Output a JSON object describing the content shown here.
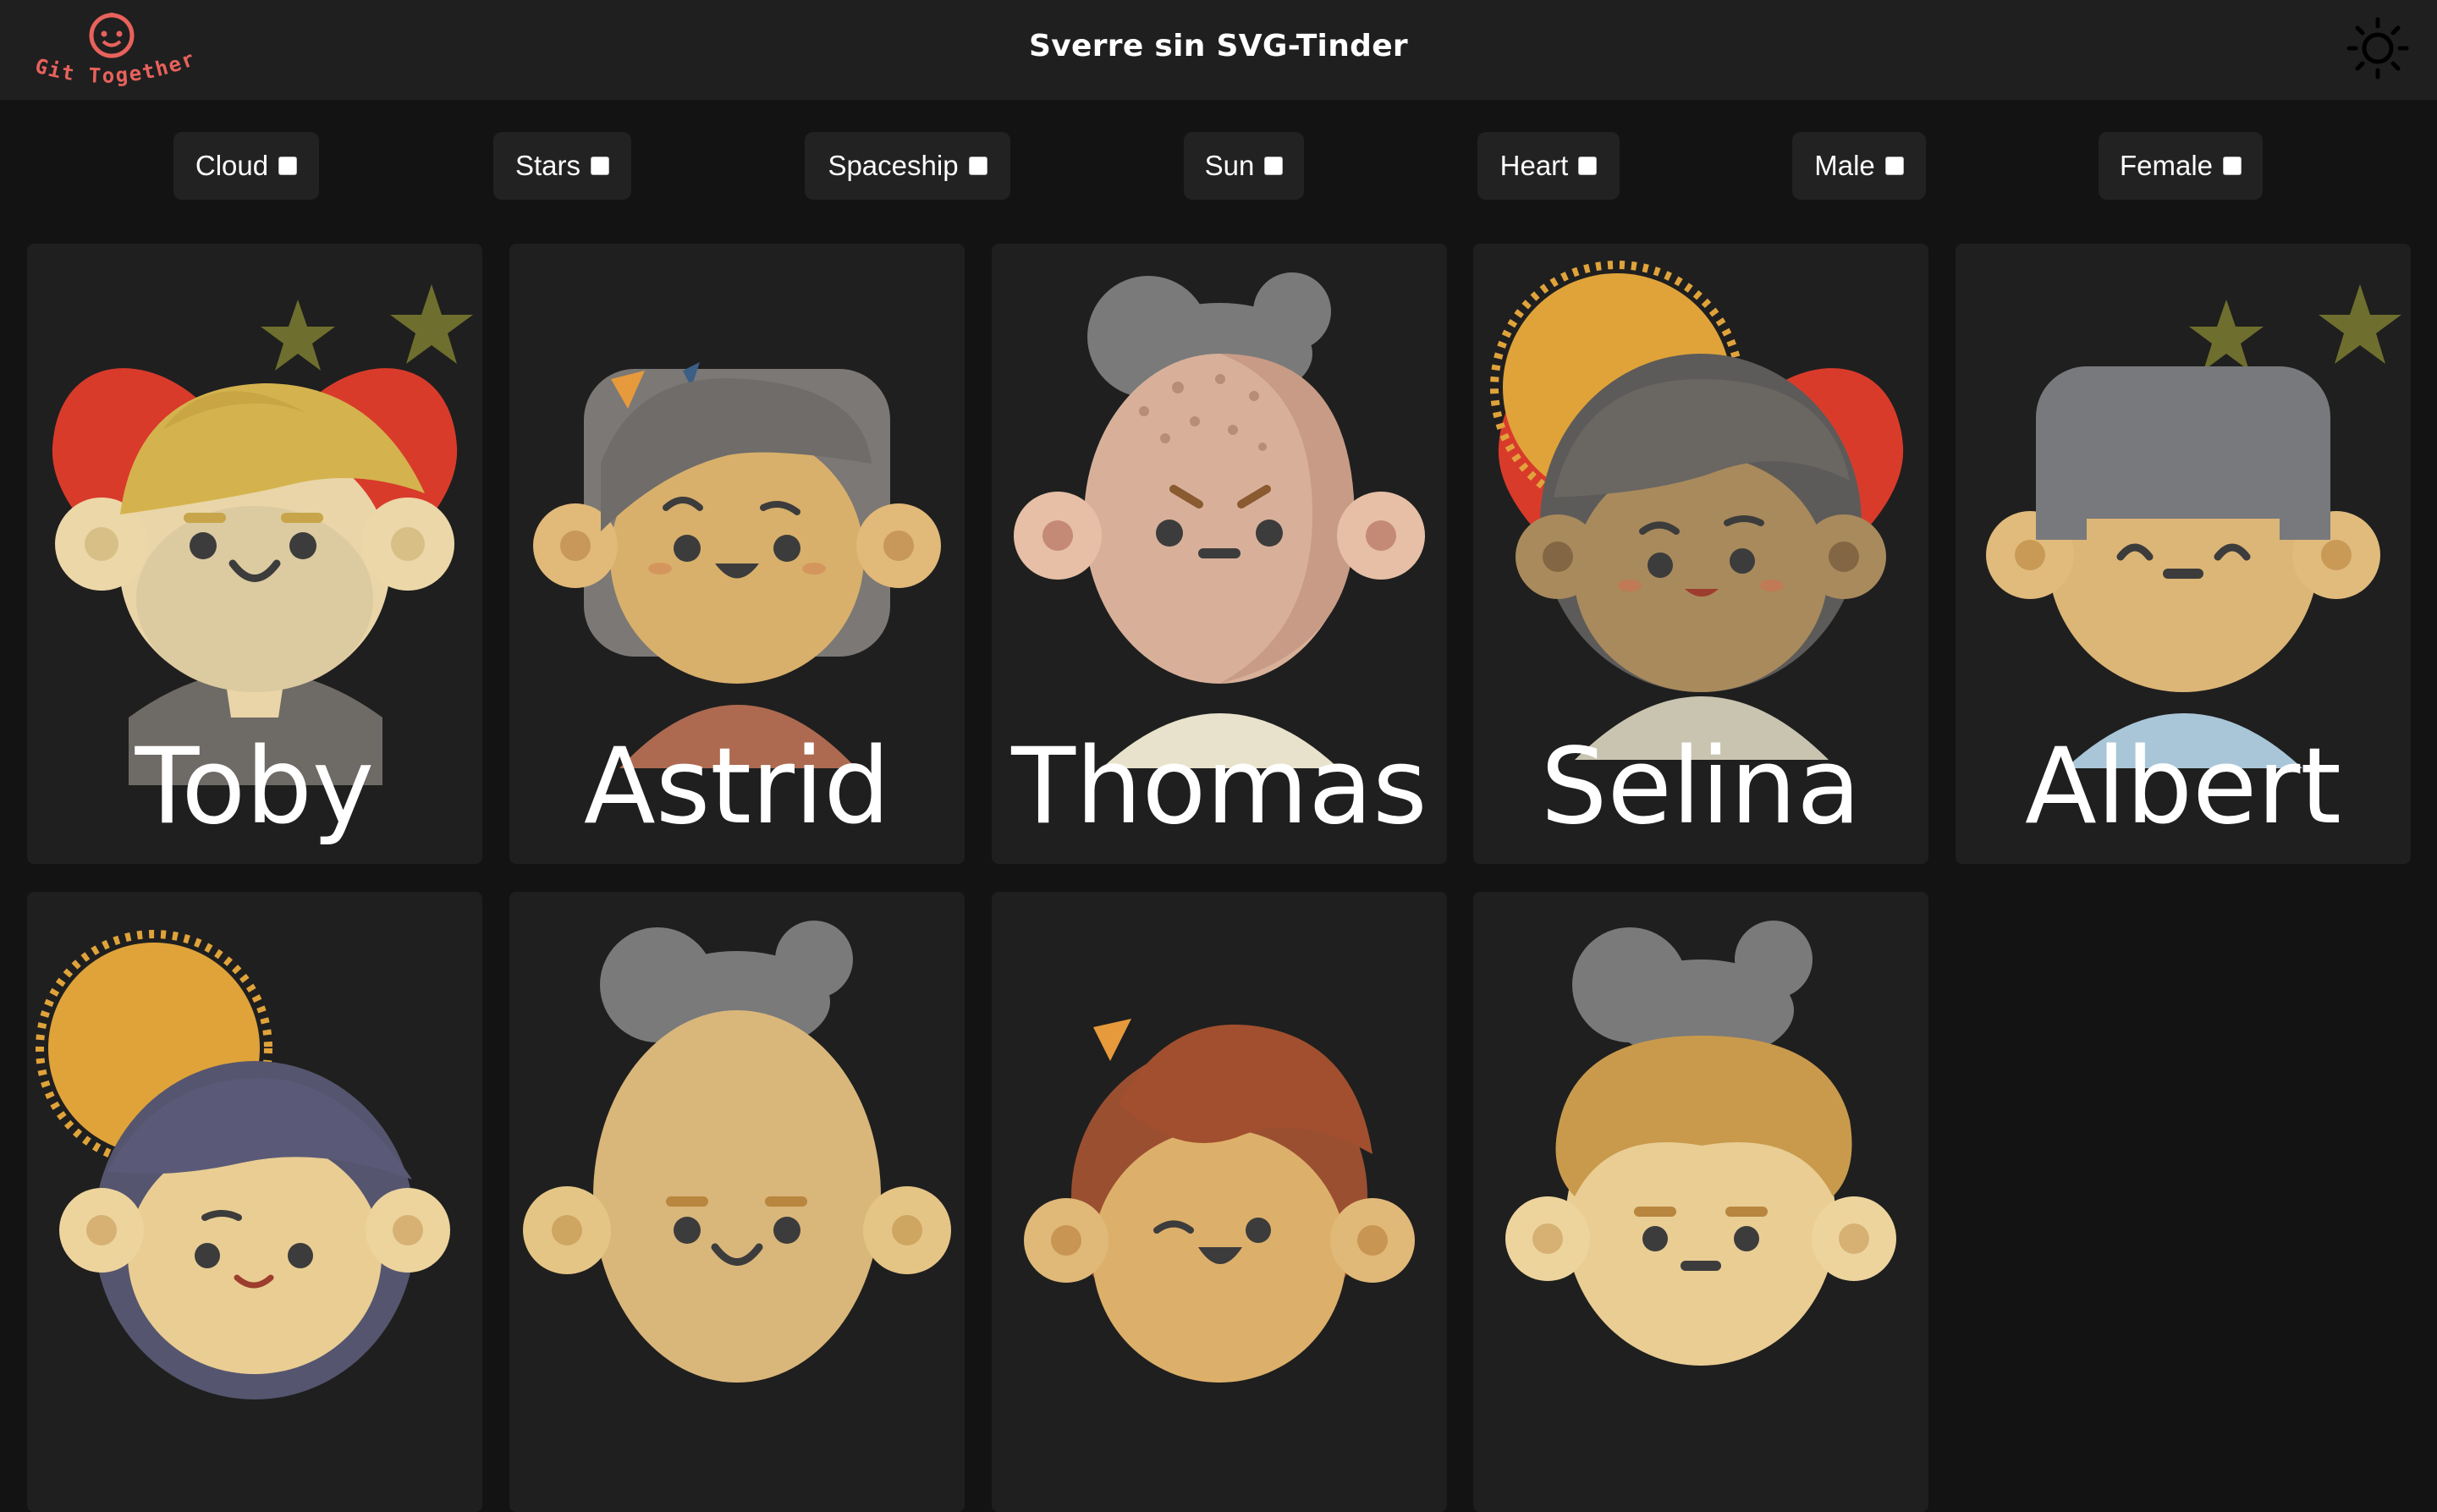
{
  "header": {
    "logo_text": "Git Together",
    "title": "Sverre sin SVG-Tinder",
    "theme_icon": "sun-icon"
  },
  "filters": [
    {
      "label": "Cloud",
      "checked": false
    },
    {
      "label": "Stars",
      "checked": false
    },
    {
      "label": "Spaceship",
      "checked": false
    },
    {
      "label": "Sun",
      "checked": false
    },
    {
      "label": "Heart",
      "checked": false
    },
    {
      "label": "Male",
      "checked": false
    },
    {
      "label": "Female",
      "checked": false
    }
  ],
  "profiles": [
    {
      "name": "Toby",
      "decorations": [
        "heart",
        "stars"
      ]
    },
    {
      "name": "Astrid",
      "decorations": []
    },
    {
      "name": "Thomas",
      "decorations": []
    },
    {
      "name": "Selina",
      "decorations": [
        "sun",
        "heart"
      ]
    },
    {
      "name": "Albert",
      "decorations": [
        "stars"
      ]
    },
    {
      "name": "",
      "decorations": [
        "sun"
      ]
    },
    {
      "name": "",
      "decorations": []
    },
    {
      "name": "",
      "decorations": []
    },
    {
      "name": "",
      "decorations": []
    }
  ],
  "colors": {
    "page_bg": "#131313",
    "header_bg": "#1f1f1f",
    "card_bg": "#1f1f1f",
    "chip_bg": "#222222",
    "brand": "#e8625c"
  }
}
